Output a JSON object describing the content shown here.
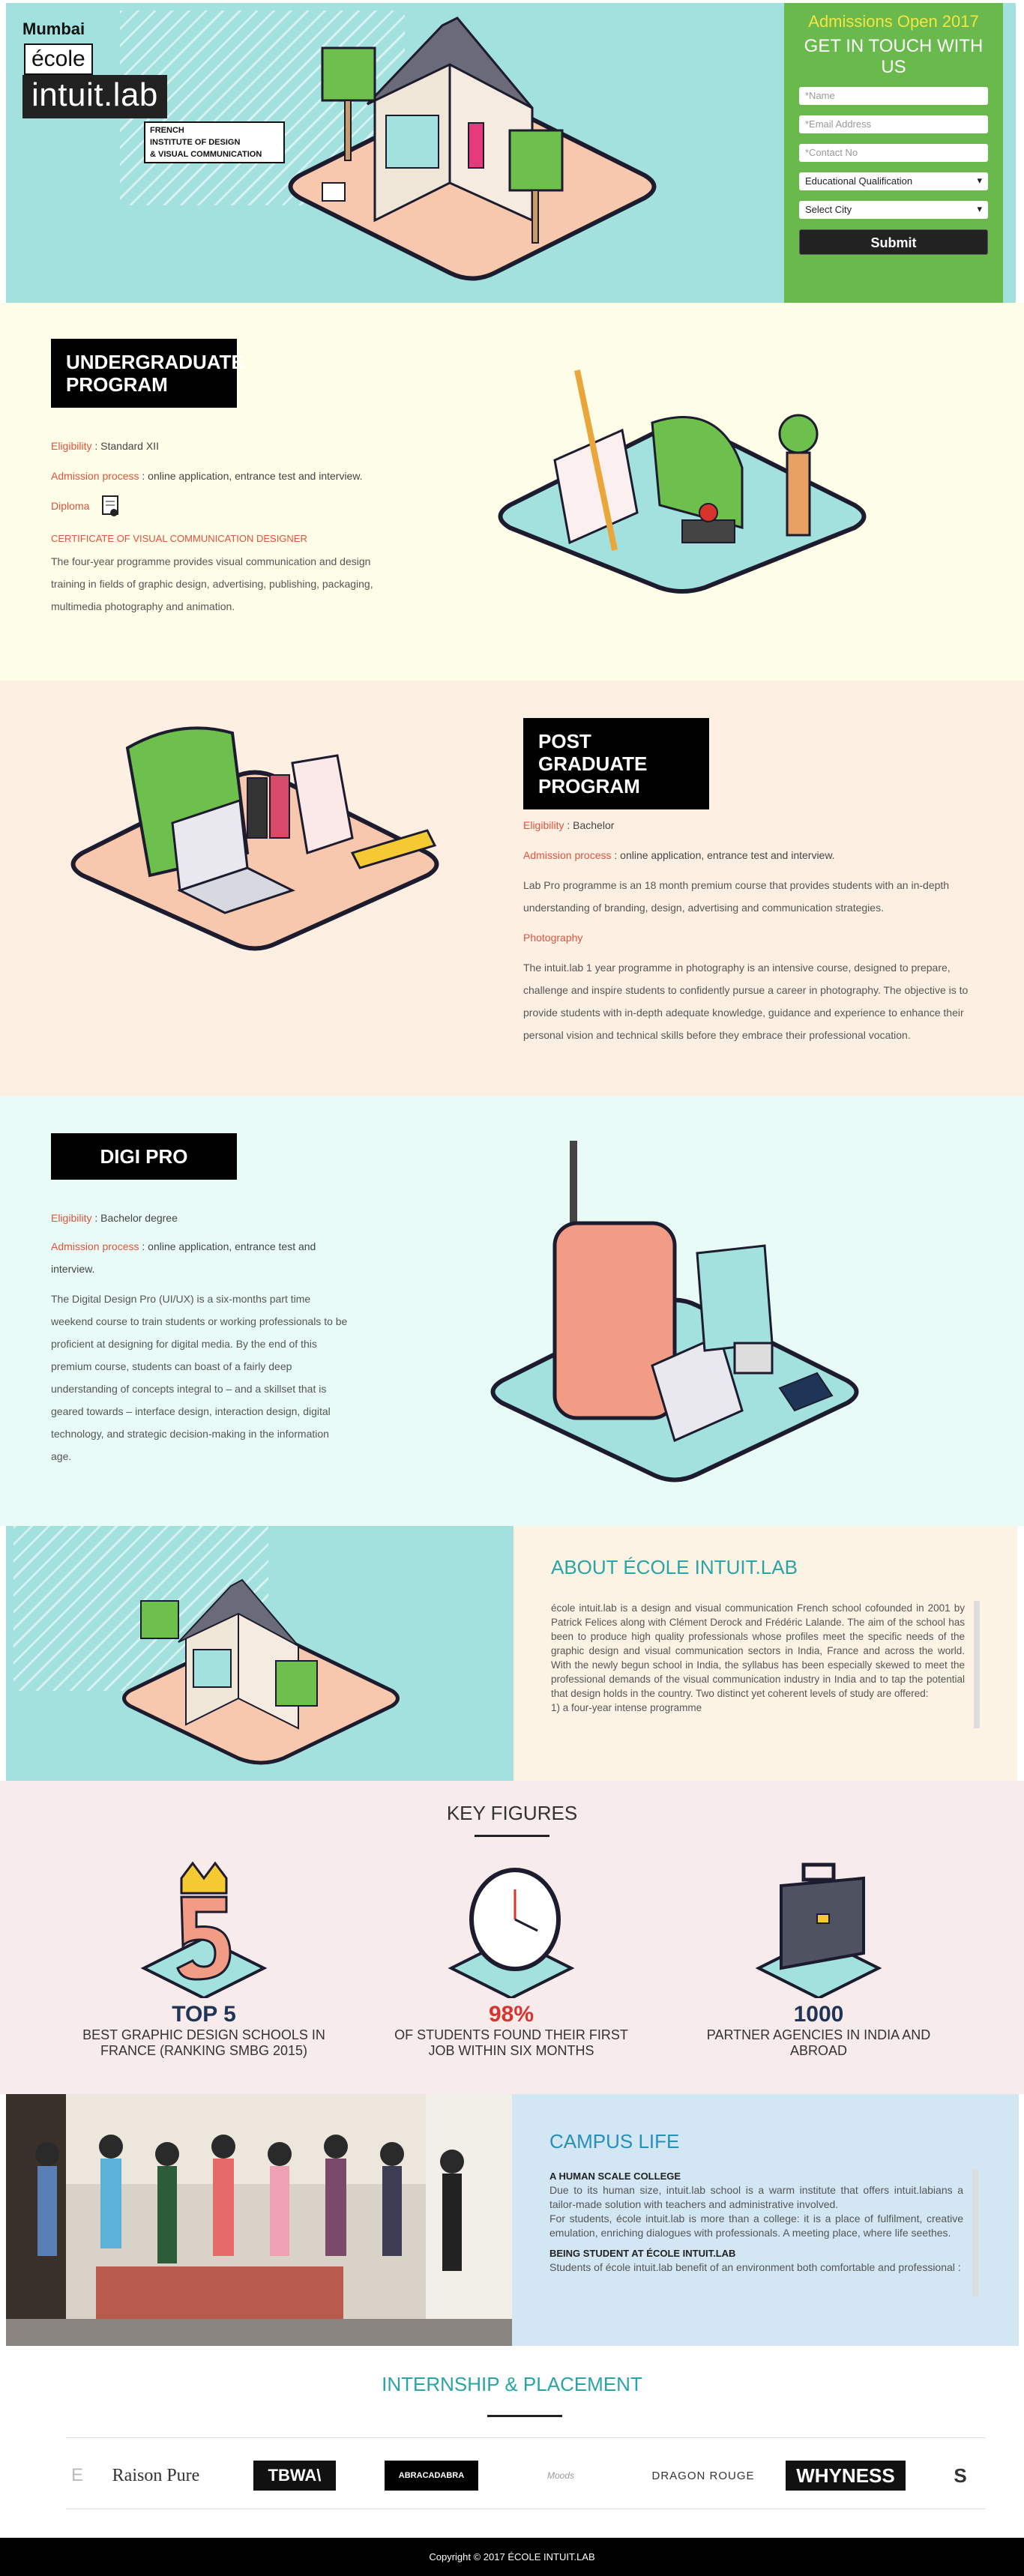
{
  "hero": {
    "logo": {
      "city": "Mumbai",
      "ecole": "école",
      "brand": "intuit.lab",
      "sub1": "FRENCH",
      "sub2": "INSTITUTE OF DESIGN",
      "sub3": "& VISUAL COMMUNICATION"
    },
    "form": {
      "admissions": "Admissions Open 2017",
      "heading": "GET IN TOUCH WITH US",
      "name_placeholder": "*Name",
      "email_placeholder": "*Email Address",
      "contact_placeholder": "*Contact No",
      "qualification": "Educational Qualification",
      "city": "Select City",
      "submit": "Submit"
    }
  },
  "ug": {
    "title1": "UNDERGRADUATE",
    "title2": "PROGRAM",
    "elig_label": "Eligibility",
    "elig_value": " : Standard XII",
    "adm_label": "Admission process",
    "adm_value": " : online application, entrance test and interview.",
    "diploma_label": "Diploma",
    "certificate": "CERTIFICATE OF VISUAL COMMUNICATION DESIGNER",
    "desc": "The four-year programme provides visual communication and design training in fields of graphic design, advertising, publishing, packaging, multimedia photography and animation."
  },
  "pg": {
    "title1": "POST GRADUATE",
    "title2": "PROGRAM",
    "elig_label": "Eligibility",
    "elig_value": " : Bachelor",
    "adm_label": "Admission process",
    "adm_value": " : online application, entrance test and interview.",
    "desc": "Lab Pro programme is an 18 month premium course that provides students with an in-depth understanding of branding, design, advertising and communication strategies.",
    "photo_label": "Photography",
    "photo_desc": "The intuit.lab 1 year programme in photography is an intensive course, designed to prepare, challenge and inspire students to confidently pursue a career in photography. The objective is to provide students with in-depth adequate knowledge, guidance and experience to enhance their personal vision and technical skills before they embrace their professional vocation."
  },
  "dp": {
    "title": "DIGI PRO",
    "elig_label": "Eligibility",
    "elig_value": " : Bachelor degree",
    "adm_label": "Admission process",
    "adm_value": " : online application, entrance test and interview.",
    "desc": "The Digital Design Pro (UI/UX) is a six-months part time weekend course to train students or working professionals to be proficient at designing for digital media. By the end of this premium course, students can boast of a fairly deep understanding of concepts integral to – and a skillset that is geared towards – interface design, interaction design, digital technology, and strategic decision-making in the information age."
  },
  "about": {
    "title": "ABOUT ÉCOLE INTUIT.LAB",
    "text": "école intuit.lab is a design and visual communication French school cofounded in 2001 by Patrick Felices along with Clément Derock and Frédéric Lalande. The aim of the school has been to produce high quality professionals whose profiles meet the specific needs of the graphic design and visual communication sectors in India, France and across the world. With the newly begun school in India, the syllabus has been especially skewed to meet the professional demands of the visual communication industry in India and to tap the potential that design holds in the country. Two distinct yet coherent levels of study are offered:",
    "item1": "1) a four-year intense programme"
  },
  "key_figures": {
    "title": "KEY FIGURES",
    "items": [
      {
        "num": "TOP 5",
        "label": "BEST GRAPHIC DESIGN SCHOOLS IN FRANCE (RANKING SMBG 2015)",
        "color": "#1e3558"
      },
      {
        "num": "98%",
        "label": "OF STUDENTS FOUND THEIR FIRST JOB WITHIN SIX MONTHS",
        "color": "#d9342b"
      },
      {
        "num": "1000",
        "label": "PARTNER AGENCIES IN INDIA AND ABROAD",
        "color": "#1e3558"
      }
    ]
  },
  "campus": {
    "title": "CAMPUS LIFE",
    "h1": "A HUMAN SCALE COLLEGE",
    "p1": "Due to its human size, intuit.lab school is a warm institute that offers intuit.labians a tailor-made solution with teachers and administrative involved.",
    "p2": "For students, école intuit.lab is more than a college: it is a place of fulfilment, creative emulation, enriching dialogues with professionals. A meeting place, where life seethes.",
    "h2": "BEING STUDENT AT ÉCOLE INTUIT.LAB",
    "p3": "Students of école intuit.lab benefit of an environment both comfortable and professional :"
  },
  "internship": {
    "title": "INTERNSHIP & PLACEMENT",
    "partners": [
      "E",
      "Raison Pure",
      "TBWA\\",
      "ABRACADABRA",
      "Moods",
      "DRAGON ROUGE",
      "WHYNESS",
      "S"
    ]
  },
  "footer": {
    "text": "Copyright © 2017 ÉCOLE INTUIT.LAB"
  }
}
